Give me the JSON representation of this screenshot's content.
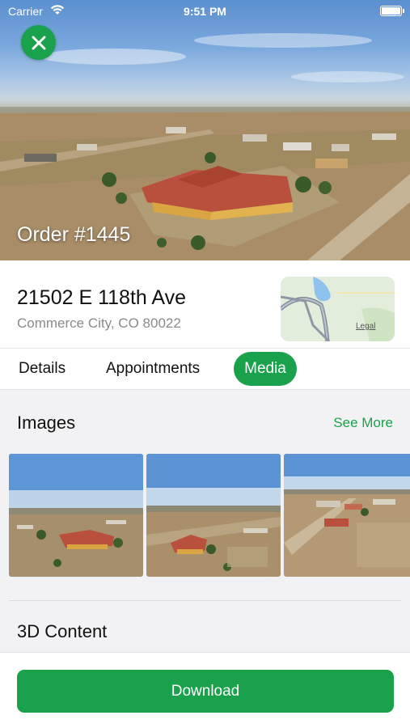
{
  "status_bar": {
    "carrier": "Carrier",
    "time": "9:51 PM"
  },
  "hero": {
    "order_title": "Order #1445"
  },
  "address": {
    "line1": "21502 E 118th Ave",
    "line2": "Commerce City, CO 80022",
    "map_legal": "Legal"
  },
  "tabs": [
    {
      "label": "Details",
      "active": false
    },
    {
      "label": "Appointments",
      "active": false
    },
    {
      "label": "Media",
      "active": true
    }
  ],
  "images_section": {
    "title": "Images",
    "see_more": "See More"
  },
  "content_section": {
    "title": "3D Content"
  },
  "download_button": {
    "label": "Download"
  },
  "colors": {
    "accent": "#19a24b",
    "secondary_text": "#8a8a8e",
    "background": "#f2f2f4"
  }
}
